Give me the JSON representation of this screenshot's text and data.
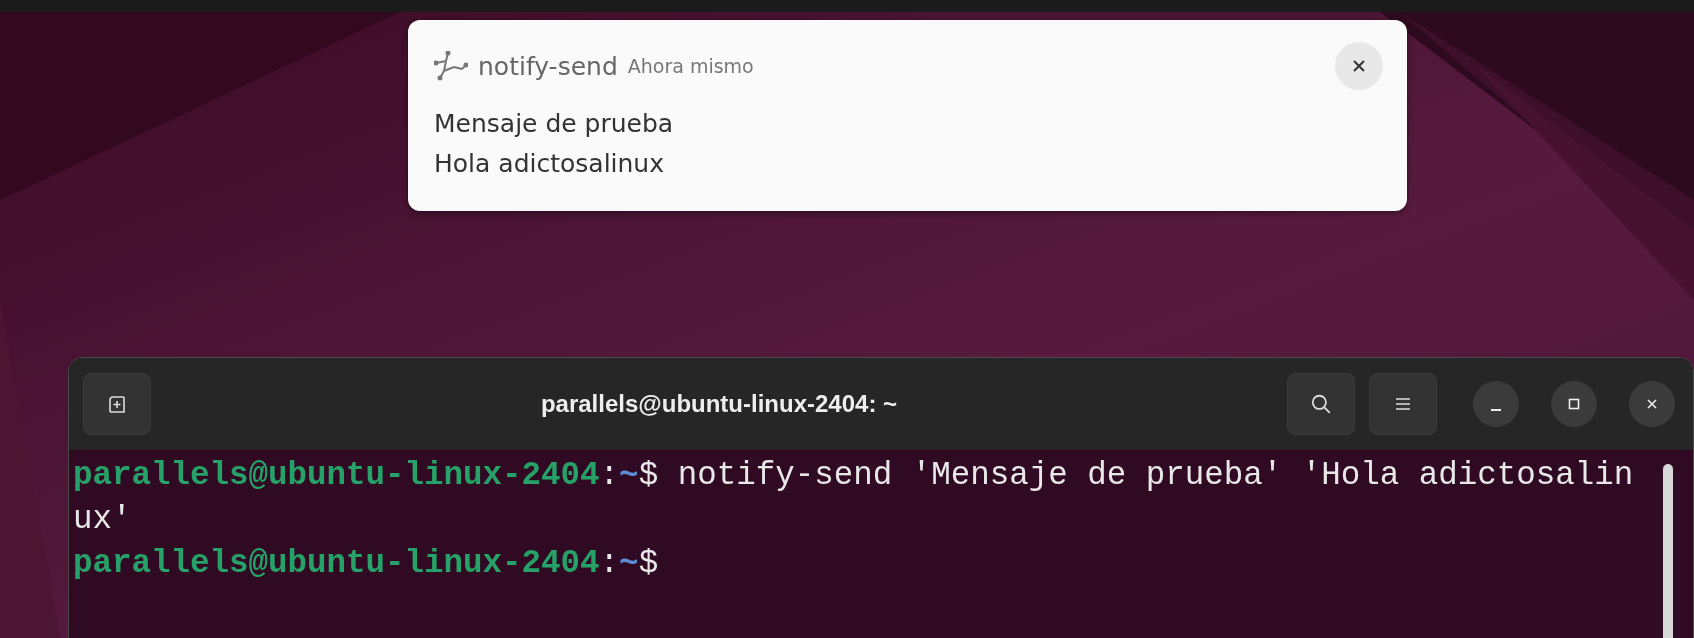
{
  "notification": {
    "app_name": "notify-send",
    "time": "Ahora mismo",
    "summary": "Mensaje de prueba",
    "body": "Hola adictosalinux"
  },
  "terminal": {
    "title": "parallels@ubuntu-linux-2404: ~",
    "lines": [
      {
        "segments": [
          {
            "kind": "user",
            "text": "parallels@ubuntu-linux-2404"
          },
          {
            "kind": "plain",
            "text": ":"
          },
          {
            "kind": "path",
            "text": "~"
          },
          {
            "kind": "plain",
            "text": "$ notify-send 'Mensaje de prueba' 'Hola adictosalin"
          }
        ]
      },
      {
        "segments": [
          {
            "kind": "plain",
            "text": "ux'"
          }
        ]
      },
      {
        "segments": [
          {
            "kind": "user",
            "text": "parallels@ubuntu-linux-2404"
          },
          {
            "kind": "plain",
            "text": ":"
          },
          {
            "kind": "path",
            "text": "~"
          },
          {
            "kind": "plain",
            "text": "$"
          }
        ]
      }
    ]
  }
}
